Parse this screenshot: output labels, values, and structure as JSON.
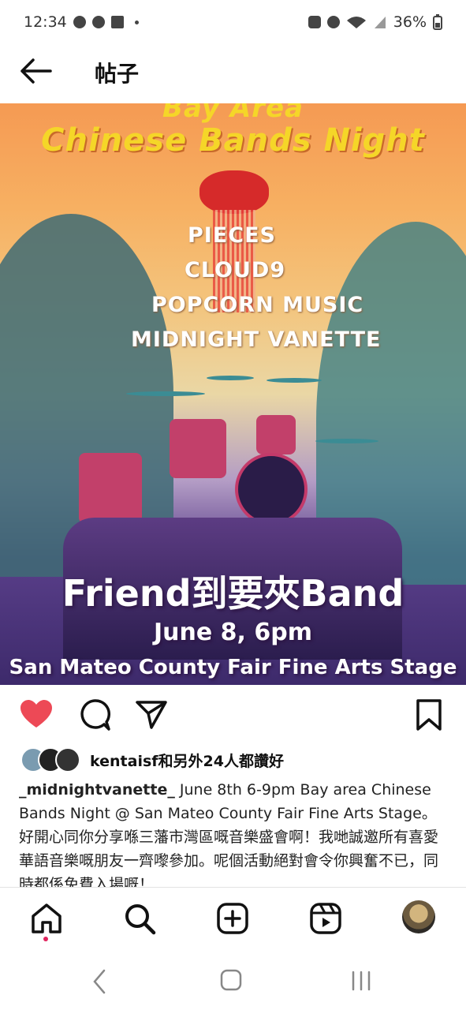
{
  "status_bar": {
    "time": "12:34",
    "battery": "36%"
  },
  "header": {
    "title": "帖子"
  },
  "poster": {
    "title_top": "Bay Area",
    "title_main": "Chinese Bands Night",
    "lineup": [
      "PIECES",
      "CLOUD9",
      "POPCORN MUSIC",
      "MIDNIGHT VANETTE"
    ],
    "band_name": "Friend到要夾Band",
    "date": "June 8, 6pm",
    "venue": "San Mateo County Fair Fine Arts Stage"
  },
  "likes": {
    "text": "kentaisf和另外24人都讚好"
  },
  "caption": {
    "username": "_midnightvanette_",
    "text": " June 8th 6-9pm Bay area Chinese Bands Night @ San Mateo County Fair Fine Arts Stage。好開心同你分享喺三藩市灣區嘅音樂盛會啊！我哋誠邀所有喜愛華語音樂嘅朋友一齊嚟參加。呢個活動絕對會令你興奮不已，同時都係免費入場嘅！"
  },
  "icons": {
    "heart": "heart-icon-filled",
    "comment": "comment-icon",
    "share": "send-icon",
    "save": "bookmark-icon",
    "nav": [
      "home-icon",
      "search-icon",
      "create-icon",
      "reels-icon",
      "profile-avatar"
    ]
  },
  "colors": {
    "like_red": "#ed4956",
    "poster_yellow": "#f5d628",
    "notification_dot": "#e0245e"
  }
}
